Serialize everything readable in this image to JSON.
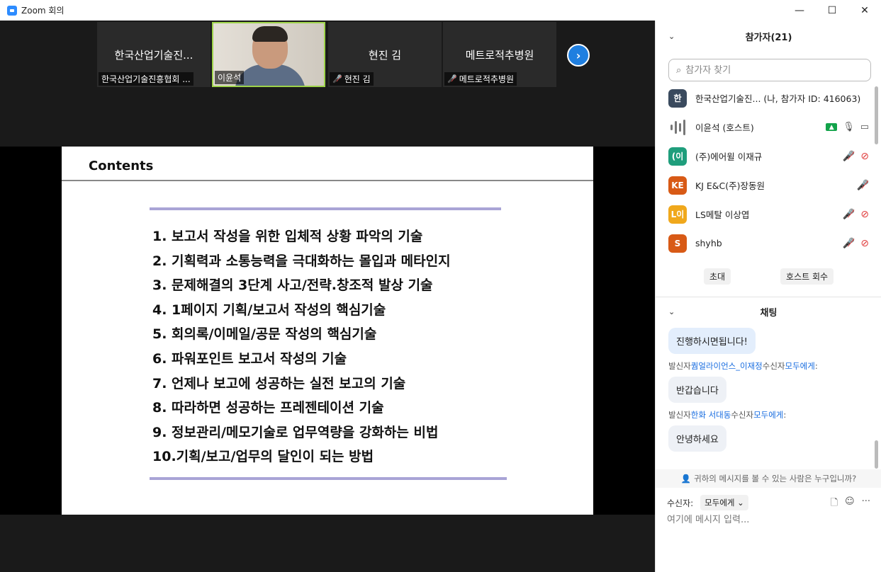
{
  "window": {
    "title": "Zoom 회의",
    "minimize": "—",
    "maximize": "☐",
    "close": "✕"
  },
  "gallery": {
    "tiles": [
      {
        "name": "한국산업기술진...",
        "label": "한국산업기술진흥협회 ..."
      },
      {
        "name": "",
        "label": "이윤석"
      },
      {
        "name": "현진 김",
        "label": "현진 김"
      },
      {
        "name": "메트로적추병원",
        "label": "메트로적추병원"
      }
    ],
    "next": "›"
  },
  "slide": {
    "title": "Contents",
    "items": [
      "1. 보고서 작성을 위한 입체적 상황 파악의 기술",
      "2. 기획력과 소통능력을 극대화하는 몰입과 메타인지",
      "3. 문제해결의 3단계 사고/전략.창조적 발상 기술",
      "4. 1페이지 기획/보고서 작성의 핵심기술",
      "5. 회의록/이메일/공문 작성의 핵심기술",
      "6. 파워포인트 보고서 작성의 기술",
      "7. 언제나 보고에 성공하는 실전 보고의 기술",
      "8. 따라하면 성공하는 프레젠테이션 기술",
      "9. 정보관리/메모기술로 업무역량을 강화하는 비법",
      "10.기획/보고/업무의 달인이 되는 방법"
    ]
  },
  "participants": {
    "header": "참가자(21)",
    "search_placeholder": "참가자 찾기",
    "list": [
      {
        "avatar": "한",
        "color": "#3a4a5e",
        "name": "한국산업기술진...",
        "extra": "(나, 참가자 ID: 416063)"
      },
      {
        "avatar": "",
        "color": "#ffffff",
        "name": "이윤석 (호스트)",
        "extra": ""
      },
      {
        "avatar": "(이",
        "color": "#1f9e7c",
        "name": "(주)에어윌 이재규",
        "extra": ""
      },
      {
        "avatar": "KE",
        "color": "#d85a16",
        "name": "KJ E&C(주)장동원",
        "extra": ""
      },
      {
        "avatar": "L이",
        "color": "#f0a81c",
        "name": "LS메탈 이상엽",
        "extra": ""
      },
      {
        "avatar": "S",
        "color": "#d85a16",
        "name": "shyhb",
        "extra": ""
      }
    ],
    "invite": "초대",
    "reclaim_host": "호스트 회수"
  },
  "chat": {
    "header": "채팅",
    "messages": [
      {
        "text": "진행하시면됩니다!"
      },
      {
        "sender_prefix": "발신자",
        "sender": "퀌얼라이언스_이재정",
        "to_prefix": "수신자",
        "to": "모두에게",
        "text": "반갑습니다"
      },
      {
        "sender_prefix": "발신자",
        "sender": "한화 서대동",
        "to_prefix": "수신자",
        "to": "모두에게",
        "text": "안녕하세요"
      }
    ],
    "privacy": "귀하의 메시지를 볼 수 있는 사람은 누구입니까?",
    "to_label": "수신자:",
    "to_value": "모두에게",
    "input_placeholder": "여기에 메시지 입력..."
  }
}
